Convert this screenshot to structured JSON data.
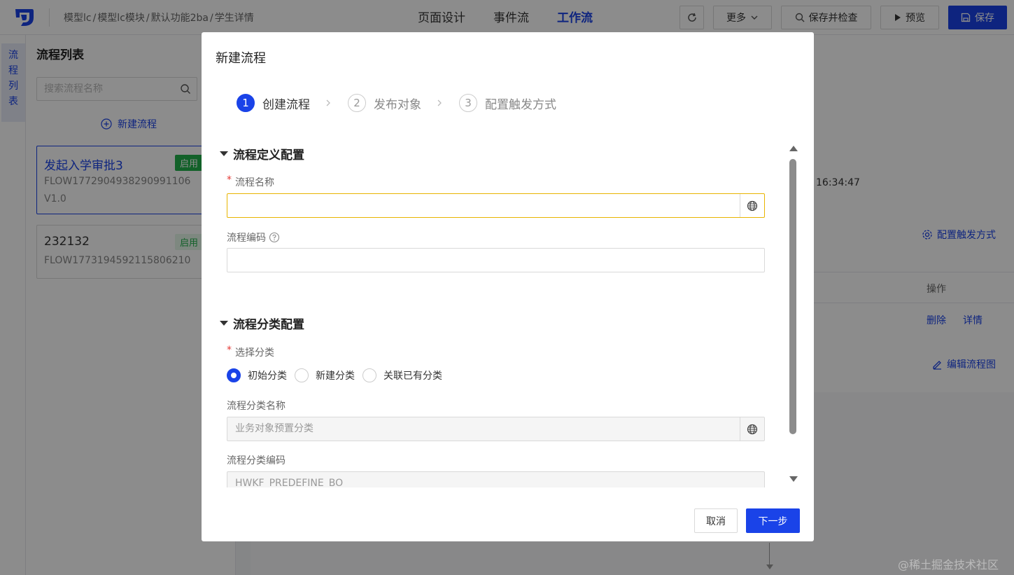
{
  "topbar": {
    "breadcrumb": [
      "模型lc",
      "模型lc模块",
      "默认功能2ba",
      "学生详情"
    ],
    "breadcrumb_sep": "/",
    "tabs": [
      {
        "label": "页面设计",
        "active": false
      },
      {
        "label": "事件流",
        "active": false
      },
      {
        "label": "工作流",
        "active": true
      }
    ],
    "more_label": "更多",
    "save_check_label": "保存并检查",
    "preview_label": "预览",
    "save_label": "保存"
  },
  "rail": {
    "tab_label": [
      "流",
      "程",
      "列",
      "表"
    ]
  },
  "flow_list": {
    "title": "流程列表",
    "search_placeholder": "搜索流程名称",
    "new_flow_label": "新建流程",
    "items": [
      {
        "name": "发起入学审批3",
        "code": "FLOW1772904938290991106",
        "version": "V1.0",
        "status": "启用",
        "selected": true
      },
      {
        "name": "232132",
        "code": "FLOW1773194592115806210",
        "status": "启用",
        "selected": false
      }
    ]
  },
  "background": {
    "time": "16:34:47",
    "config_trigger_label": "配置触发方式",
    "ops_header": "操作",
    "delete_label": "删除",
    "detail_label": "详情",
    "edit_diagram_label": "编辑流程图",
    "watermark": "@稀土掘金技术社区"
  },
  "modal": {
    "title": "新建流程",
    "steps": [
      {
        "num": "1",
        "label": "创建流程",
        "active": true
      },
      {
        "num": "2",
        "label": "发布对象",
        "active": false
      },
      {
        "num": "3",
        "label": "配置触发方式",
        "active": false
      }
    ],
    "section_definition": "流程定义配置",
    "name_label": "流程名称",
    "name_value": "",
    "code_label": "流程编码",
    "code_value": "",
    "section_category": "流程分类配置",
    "category_select_label": "选择分类",
    "category_options": [
      {
        "label": "初始分类",
        "checked": true
      },
      {
        "label": "新建分类",
        "checked": false
      },
      {
        "label": "关联已有分类",
        "checked": false
      }
    ],
    "category_name_label": "流程分类名称",
    "category_name_value": "业务对象预置分类",
    "category_code_label": "流程分类编码",
    "category_code_value": "HWKF_PREDEFINE_BO",
    "cancel_label": "取消",
    "next_label": "下一步"
  },
  "colors": {
    "primary": "#1a43e8",
    "success": "#22b14c",
    "focus_border": "#e8b400",
    "required": "#e53935"
  }
}
